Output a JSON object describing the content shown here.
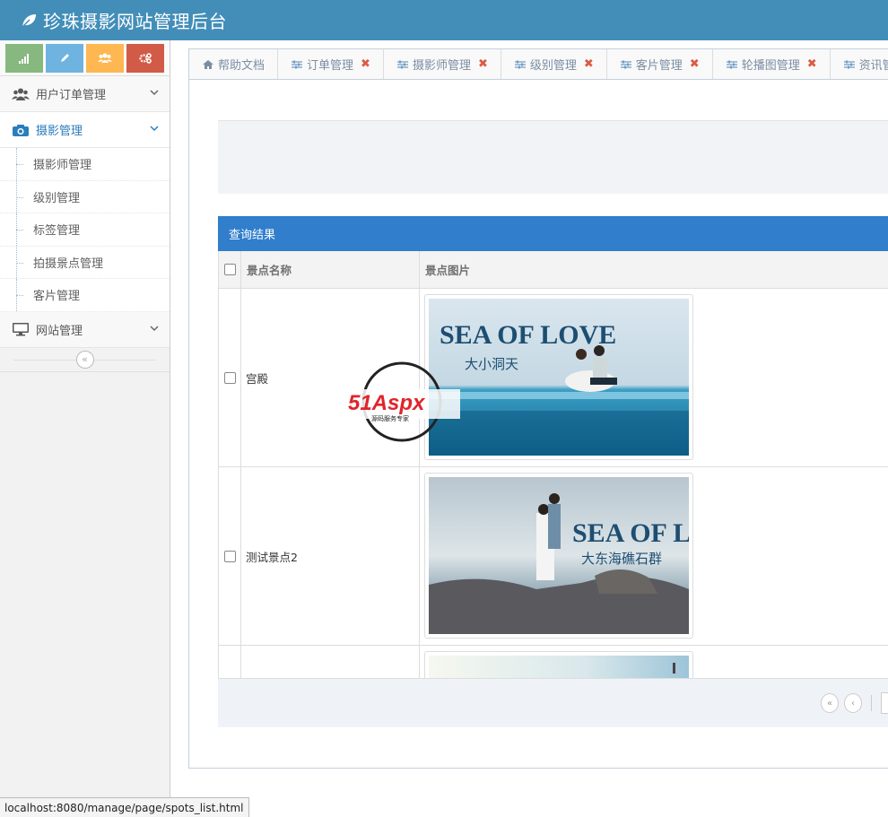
{
  "header": {
    "title": "珍珠摄影网站管理后台"
  },
  "shortcuts": [
    {
      "icon": "signal-icon",
      "color": "#87b87f"
    },
    {
      "icon": "pencil-icon",
      "color": "#6fb3e0"
    },
    {
      "icon": "users-icon",
      "color": "#ffb752"
    },
    {
      "icon": "cogs-icon",
      "color": "#d15b47"
    }
  ],
  "sidebar": {
    "groups": [
      {
        "label": "用户订单管理",
        "icon": "users-icon"
      },
      {
        "label": "摄影管理",
        "icon": "camera-icon",
        "items": [
          "摄影师管理",
          "级别管理",
          "标签管理",
          "拍摄景点管理",
          "客片管理"
        ]
      },
      {
        "label": "网站管理",
        "icon": "monitor-icon"
      }
    ]
  },
  "tabs": [
    {
      "label": "帮助文档",
      "icon": "home-icon",
      "closable": false
    },
    {
      "label": "订单管理",
      "icon": "sliders-icon",
      "closable": true
    },
    {
      "label": "摄影师管理",
      "icon": "sliders-icon",
      "closable": true
    },
    {
      "label": "级别管理",
      "icon": "sliders-icon",
      "closable": true
    },
    {
      "label": "客片管理",
      "icon": "sliders-icon",
      "closable": true
    },
    {
      "label": "轮播图管理",
      "icon": "sliders-icon",
      "closable": true
    },
    {
      "label": "资讯管理",
      "icon": "sliders-icon",
      "closable": true
    }
  ],
  "close_glyph": "✖",
  "result": {
    "title": "查询结果",
    "columns": [
      "景点名称",
      "景点图片"
    ],
    "rows": [
      {
        "name": "宫殿",
        "image_text": "SEA OF LOVE",
        "image_subtext": "大小洞天"
      },
      {
        "name": "测试景点2",
        "image_text": "SEA OF LOVE",
        "image_subtext": "大东海礁石群"
      },
      {
        "name": "",
        "image_text": "",
        "image_subtext": ""
      }
    ]
  },
  "watermark": {
    "brand": "51Aspx",
    "tagline": "源码服务专家"
  },
  "status_url": "localhost:8080/manage/page/spots_list.html",
  "colors": {
    "header": "#438eb9",
    "result_header": "#307ecc",
    "tab_text": "#7a8ea3",
    "close": "#dd5a43"
  }
}
